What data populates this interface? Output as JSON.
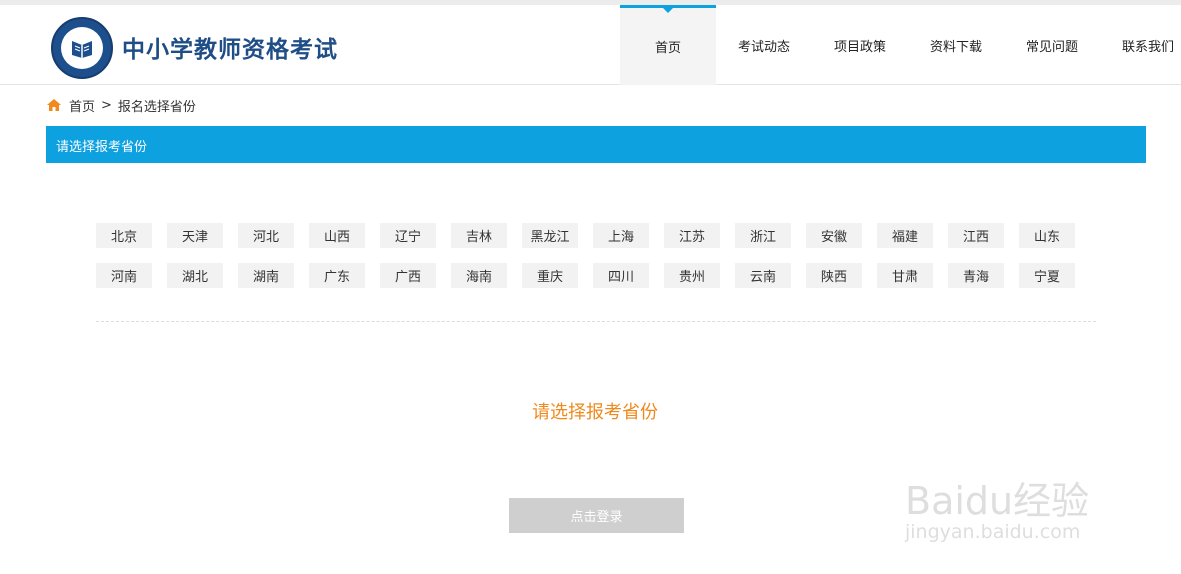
{
  "site": {
    "title": "中小学教师资格考试"
  },
  "nav": {
    "items": [
      {
        "label": "首页"
      },
      {
        "label": "考试动态"
      },
      {
        "label": "项目政策"
      },
      {
        "label": "资料下载"
      },
      {
        "label": "常见问题"
      },
      {
        "label": "联系我们"
      }
    ],
    "active_index": 0
  },
  "breadcrumb": {
    "home": "首页",
    "separator": ">",
    "current": "报名选择省份"
  },
  "section": {
    "title": "请选择报考省份"
  },
  "provinces": {
    "row1": [
      "北京",
      "天津",
      "河北",
      "山西",
      "辽宁",
      "吉林",
      "黑龙江",
      "上海",
      "江苏",
      "浙江",
      "安徽",
      "福建",
      "江西",
      "山东"
    ],
    "row2": [
      "河南",
      "湖北",
      "湖南",
      "广东",
      "广西",
      "海南",
      "重庆",
      "四川",
      "贵州",
      "云南",
      "陕西",
      "甘肃",
      "青海",
      "宁夏"
    ]
  },
  "prompt": "请选择报考省份",
  "login_button": "点击登录",
  "watermark": {
    "brand": "Baidu经验",
    "url": "jingyan.baidu.com"
  },
  "colors": {
    "accent": "#0ea1e0",
    "prompt": "#ee8a1d",
    "brand": "#1f4d86"
  }
}
